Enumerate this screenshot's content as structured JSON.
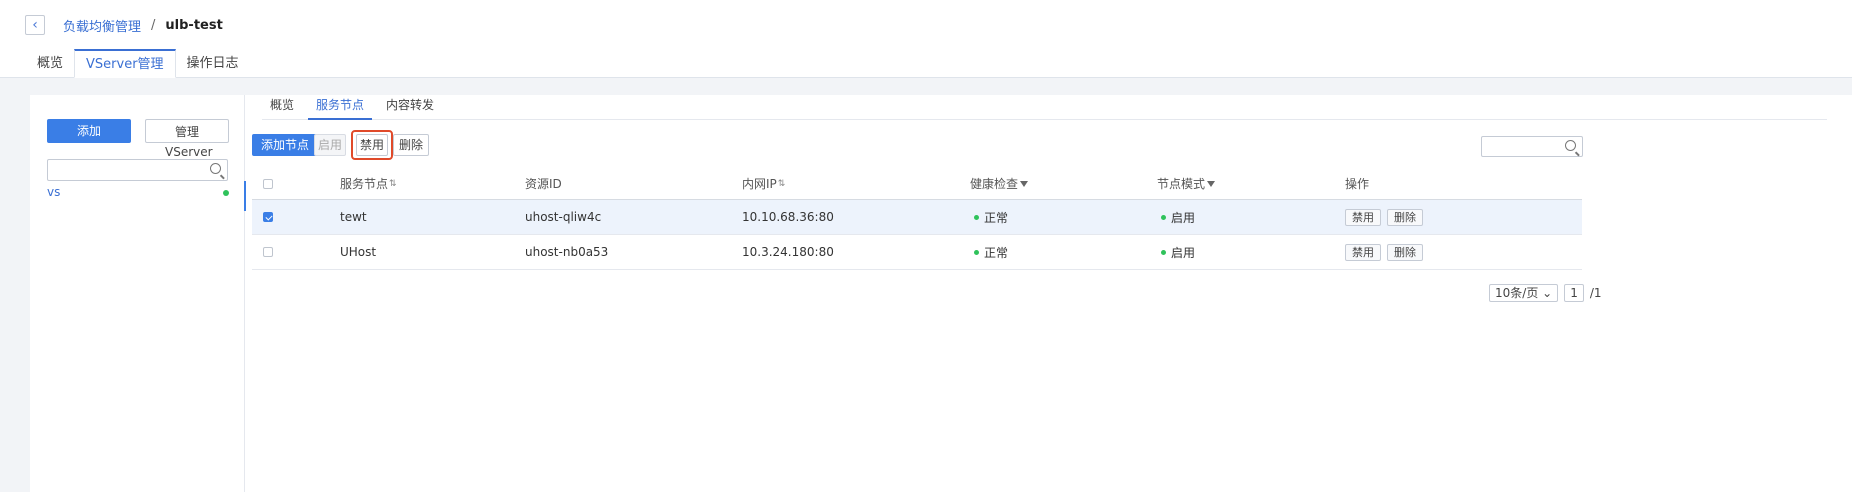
{
  "breadcrumb": {
    "back_icon": "chevron-left-icon",
    "parent": "负载均衡管理",
    "separator": "/",
    "current": "ulb-test"
  },
  "top_tabs": [
    {
      "label": "概览",
      "active": false
    },
    {
      "label": "VServer管理",
      "active": true
    },
    {
      "label": "操作日志",
      "active": false
    }
  ],
  "sidebar": {
    "add_label": "添加",
    "manage_label": "管理",
    "manage_sub": "VServer",
    "search_placeholder": "",
    "items": [
      {
        "label": "vs",
        "status_color": "#2fc25b"
      }
    ]
  },
  "sub_tabs": [
    {
      "label": "概览",
      "active": false
    },
    {
      "label": "服务节点",
      "active": true
    },
    {
      "label": "内容转发",
      "active": false
    }
  ],
  "toolbar": {
    "add_node": "添加节点",
    "enable": "启用",
    "disable": "禁用",
    "delete": "删除",
    "search_placeholder": ""
  },
  "table": {
    "columns": [
      "服务节点",
      "资源ID",
      "内网IP",
      "健康检查",
      "节点模式",
      "操作"
    ],
    "rows": [
      {
        "checked": true,
        "name": "tewt",
        "resource_id": "uhost-qliw4c",
        "ip": "10.10.68.36:80",
        "health": "正常",
        "mode": "启用",
        "act_disable": "禁用",
        "act_delete": "删除"
      },
      {
        "checked": false,
        "name": "UHost",
        "resource_id": "uhost-nb0a53",
        "ip": "10.3.24.180:80",
        "health": "正常",
        "mode": "启用",
        "act_disable": "禁用",
        "act_delete": "删除"
      }
    ]
  },
  "pagination": {
    "page_size": "10条/页",
    "current": "1",
    "total": "/1"
  },
  "colors": {
    "accent": "#3a7ee6",
    "highlight": "#e04a2a",
    "ok": "#2fc25b"
  }
}
